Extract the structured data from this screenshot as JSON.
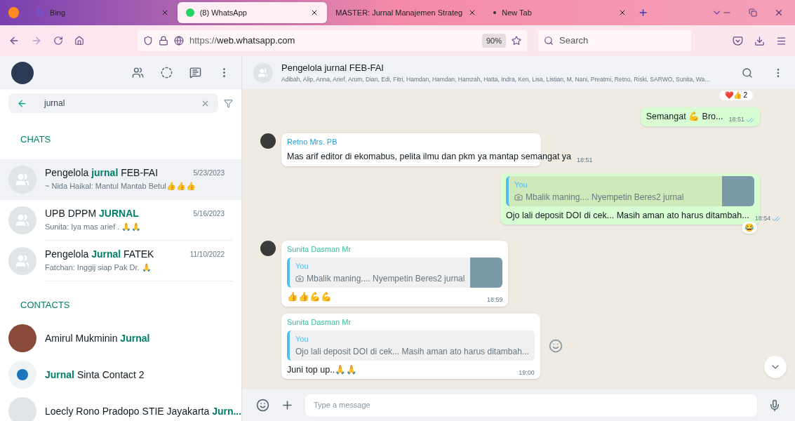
{
  "browser": {
    "tabs": [
      {
        "kind": "search",
        "title": "Bing",
        "selected": false
      },
      {
        "kind": "whatsapp",
        "title": "(8) WhatsApp",
        "selected": true
      },
      {
        "kind": "page",
        "title": "MASTER: Jurnal Manajemen Strateg",
        "selected": false
      },
      {
        "kind": "new",
        "title": "New Tab",
        "selected": false
      }
    ],
    "url": "https://**web.whatsapp.com**",
    "zoom": "90%",
    "search_placeholder": "Search"
  },
  "sidebar": {
    "search_value": "jurnal",
    "chats_heading": "CHATS",
    "chats": [
      {
        "name": "Pengelola **jurnal** FEB-FAI",
        "time": "5/23/2023",
        "preview": "~ Nida Haikal: Mantul Mantab Betul👍👍👍",
        "selected": true
      },
      {
        "name": "UPB DPPM **JURNAL**",
        "time": "5/16/2023",
        "preview": "Sunita: Iya mas arief . 🙏🙏",
        "selected": false
      },
      {
        "name": "Pengelola **Jurnal** FATEK",
        "time": "11/10/2022",
        "preview": "Fatchan: Inggij siap Pak Dr. 🙏",
        "selected": false
      }
    ],
    "contacts_heading": "CONTACTS",
    "contacts": [
      {
        "kind": "photo",
        "name": "Amirul Mukminin **Jurnal**"
      },
      {
        "kind": "logo",
        "name": "**Jurnal** Sinta Contact 2"
      },
      {
        "kind": "default",
        "name": "Loecly Rono Pradopo STIE Jayakarta **Jurn...**"
      }
    ]
  },
  "chat": {
    "title": "Pengelola jurnal FEB-FAI",
    "members": "Adibah, Alip, Anna, Arief, Arum, Dian, Edi, Fitri, Hamdan, Hamdan, Hamzah, Hatta, Indra, Ken, Lisa, Listian, M, Nani, Preatmi, Retno, Riski, SARWO, Sunita, Wa...",
    "top_reaction": "❤️👍 2",
    "messages": [
      {
        "kind": "out",
        "text": "Semangat 💪 Bro...",
        "time": "18:51",
        "read": true
      },
      {
        "kind": "in",
        "sender": "Retno Mrs. PB",
        "color": "#1f9ee0",
        "text": "Mas arif editor di ekomabus, pelita ilmu dan pkm ya mantap semangat ya",
        "time": "18:51"
      },
      {
        "kind": "out",
        "quote": {
          "author": "You",
          "text": "Mbalik maning.... Nyempetin Beres2 jurnal",
          "photo": true
        },
        "text": "Ojo lali deposit DOI di cek... Masih aman ato harus ditambah...",
        "time": "18:54",
        "read": true,
        "reaction": "😂"
      },
      {
        "kind": "in",
        "sender": "Sunita Dasman Mr",
        "color": "#35bfa5",
        "quote": {
          "author": "You",
          "text": "Mbalik maning.... Nyempetin Beres2 jurnal",
          "photo": true
        },
        "text": "👍👍💪💪",
        "time": "18:59"
      },
      {
        "kind": "in",
        "sender": "Sunita Dasman Mr",
        "color": "#35bfa5",
        "quote": {
          "author": "You",
          "text": "Ojo lali deposit DOI di cek... Masih aman ato harus ditambah...",
          "photo": false
        },
        "text": "Juni top up..🙏🙏",
        "time": "19:00",
        "hover_icon": true
      }
    ],
    "composer_placeholder": "Type a message"
  }
}
